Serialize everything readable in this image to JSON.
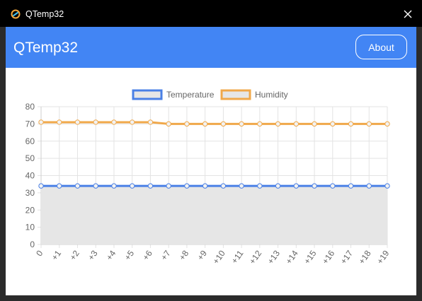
{
  "window": {
    "title": "QTemp32"
  },
  "header": {
    "title": "QTemp32",
    "about_label": "About"
  },
  "colors": {
    "accent": "#4285f4",
    "temperature": "#4a80e6",
    "humidity": "#f0a84a",
    "fill": "#e6e6e6"
  },
  "chart_data": {
    "type": "line",
    "categories": [
      "0",
      "+1",
      "+2",
      "+3",
      "+4",
      "+5",
      "+6",
      "+7",
      "+8",
      "+9",
      "+10",
      "+11",
      "+12",
      "+13",
      "+14",
      "+15",
      "+16",
      "+17",
      "+18",
      "+19"
    ],
    "series": [
      {
        "name": "Temperature",
        "values": [
          34,
          34,
          34,
          34,
          34,
          34,
          34,
          34,
          34,
          34,
          34,
          34,
          34,
          34,
          34,
          34,
          34,
          34,
          34,
          34
        ],
        "filled": true
      },
      {
        "name": "Humidity",
        "values": [
          71,
          71,
          71,
          71,
          71,
          71,
          71,
          70,
          70,
          70,
          70,
          70,
          70,
          70,
          70,
          70,
          70,
          70,
          70,
          70
        ],
        "filled": false
      }
    ],
    "ylim": [
      0,
      80
    ],
    "yticks": [
      0,
      10,
      20,
      30,
      40,
      50,
      60,
      70,
      80
    ],
    "legend": "top",
    "grid": true
  }
}
